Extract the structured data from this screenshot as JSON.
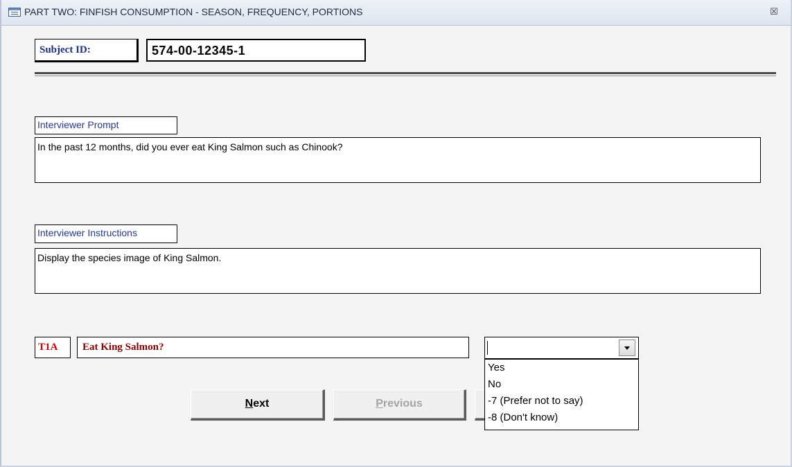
{
  "window": {
    "title": "PART TWO: FINFISH CONSUMPTION - SEASON, FREQUENCY, PORTIONS",
    "close_glyph": "☒"
  },
  "subject": {
    "label": "Subject ID:",
    "value": "574-00-12345-1"
  },
  "prompt": {
    "label": "Interviewer Prompt",
    "text": "In the past 12 months, did you ever eat King Salmon such as Chinook?"
  },
  "instructions": {
    "label": "Interviewer Instructions",
    "text": "Display the species image of King Salmon."
  },
  "question": {
    "code": "T1A",
    "text": "Eat King Salmon?",
    "answer_value": "",
    "options": [
      "Yes",
      "No",
      "-7 (Prefer not to say)",
      "-8 (Don't know)"
    ]
  },
  "buttons": {
    "next": {
      "mnemonic": "N",
      "rest": "ext"
    },
    "previous": {
      "mnemonic": "P",
      "rest": "revious"
    }
  },
  "colors": {
    "label_blue": "#27379a",
    "code_red": "#d10000",
    "question_red": "#8a0000",
    "disabled_gray": "#a4a4a4"
  }
}
